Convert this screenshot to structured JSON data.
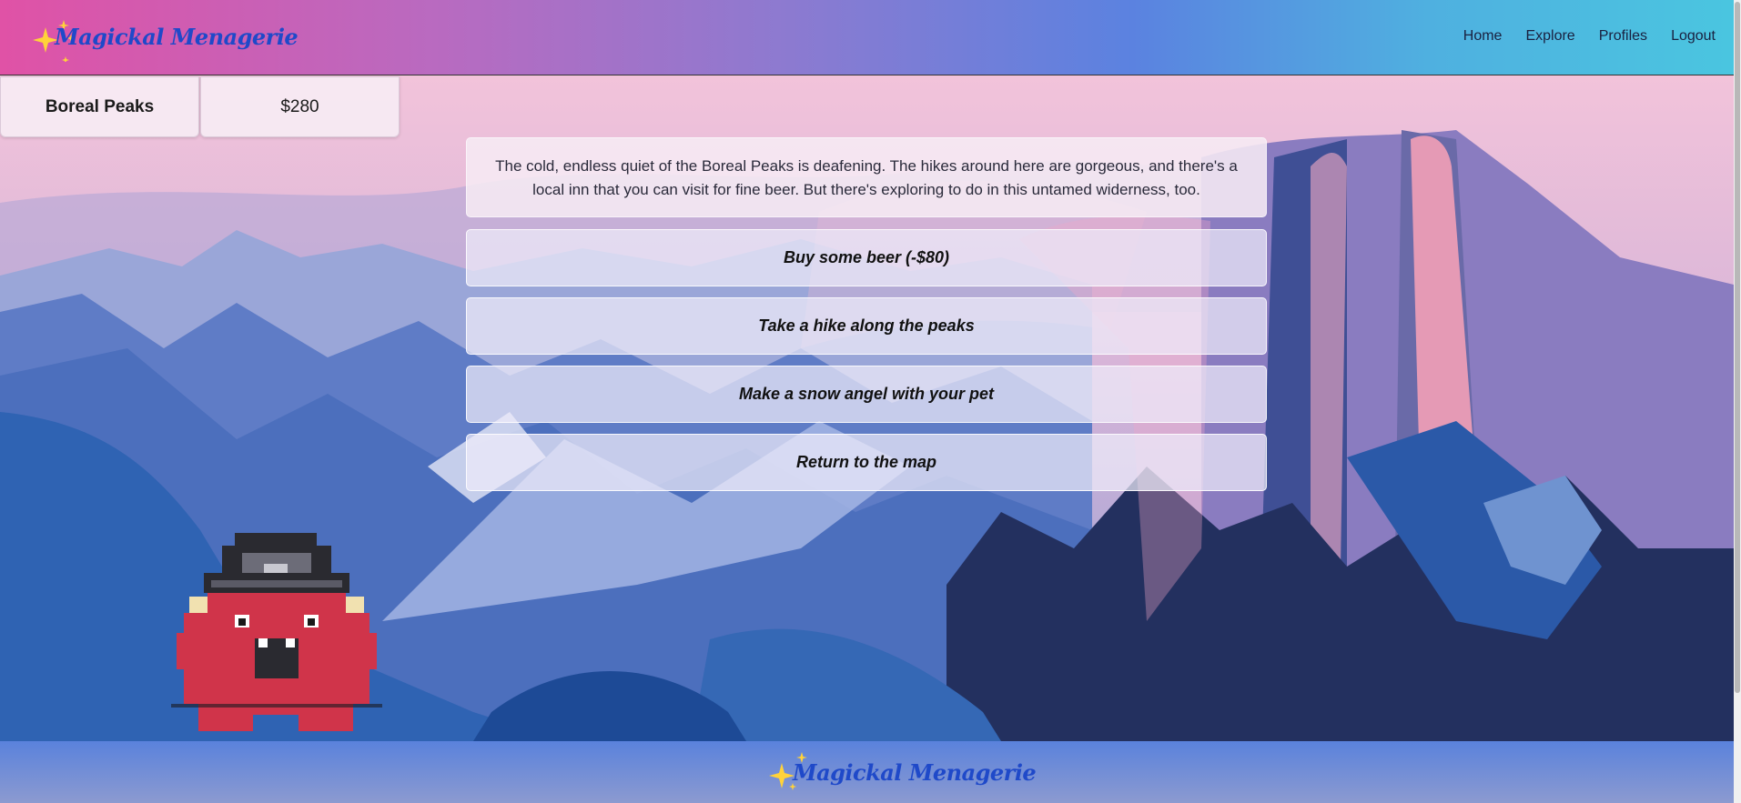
{
  "brand": {
    "name": "Magickal Menagerie"
  },
  "nav": {
    "links": [
      "Home",
      "Explore",
      "Profiles",
      "Logout"
    ]
  },
  "status": {
    "location": "Boreal Peaks",
    "money": "$280"
  },
  "description": "The cold, endless quiet of the Boreal Peaks is deafening. The hikes around here are gorgeous, and there's a local inn that you can visit for fine beer. But there's exploring to do in this untamed widerness, too.",
  "actions": [
    "Buy some beer (-$80)",
    "Take a hike along the peaks",
    "Make a snow angel with your pet"
  ],
  "return_label": "Return to the map",
  "footer": {
    "name": "Magickal Menagerie"
  },
  "colors": {
    "brand_text": "#1f49c9",
    "star": "#ffd23a",
    "pet_red": "#d0344a"
  }
}
